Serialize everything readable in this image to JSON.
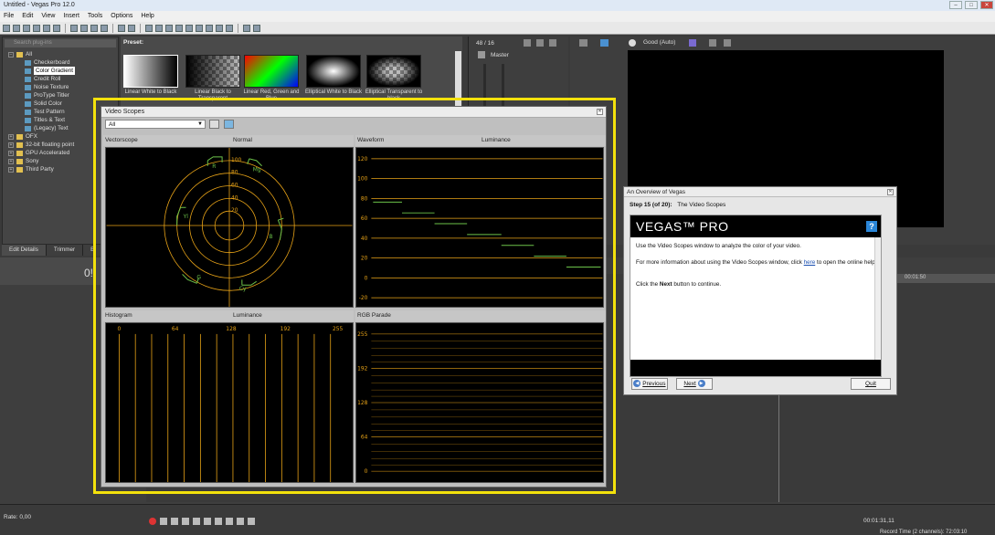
{
  "window": {
    "title": "Untitled - Vegas Pro 12.0"
  },
  "menu": [
    "File",
    "Edit",
    "View",
    "Insert",
    "Tools",
    "Options",
    "Help"
  ],
  "plugins": {
    "search_placeholder": "Search plug-ins",
    "tree": [
      {
        "label": "All",
        "level": 0,
        "type": "folder",
        "expanded": true
      },
      {
        "label": "Checkerboard",
        "level": 1,
        "type": "fx"
      },
      {
        "label": "Color Gradient",
        "level": 1,
        "type": "fx",
        "selected": true
      },
      {
        "label": "Credit Roll",
        "level": 1,
        "type": "fx"
      },
      {
        "label": "Noise Texture",
        "level": 1,
        "type": "fx"
      },
      {
        "label": "ProType Titler",
        "level": 1,
        "type": "fx"
      },
      {
        "label": "Solid Color",
        "level": 1,
        "type": "fx"
      },
      {
        "label": "Test Pattern",
        "level": 1,
        "type": "fx"
      },
      {
        "label": "Titles & Text",
        "level": 1,
        "type": "fx"
      },
      {
        "label": "(Legacy) Text",
        "level": 1,
        "type": "fx"
      },
      {
        "label": "OFX",
        "level": 0,
        "type": "folder"
      },
      {
        "label": "32-bit floating point",
        "level": 0,
        "type": "folder"
      },
      {
        "label": "GPU Accelerated",
        "level": 0,
        "type": "folder"
      },
      {
        "label": "Sony",
        "level": 0,
        "type": "folder"
      },
      {
        "label": "Third Party",
        "level": 0,
        "type": "folder"
      }
    ]
  },
  "presets": {
    "label": "Preset:",
    "items": [
      {
        "name": "Linear White to Black"
      },
      {
        "name": "Linear Black to Transparent"
      },
      {
        "name": "Linear Red, Green and Blue"
      },
      {
        "name": "Elliptical White to Black"
      },
      {
        "name": "Elliptical Transparent to black"
      }
    ]
  },
  "bottom_tabs": [
    "Edit Details",
    "Trimmer",
    "E"
  ],
  "mixer": {
    "count": "48 / 16",
    "bus": "Master"
  },
  "preview": {
    "quality": "Good (Auto)"
  },
  "ruler": {
    "time": "00:01:50"
  },
  "status": {
    "rate": "Rate: 0,00",
    "time": "00:01:31,11",
    "record_time": "Record Time (2 channels): 72:03:10"
  },
  "scopes": {
    "title": "Video Scopes",
    "source": "All",
    "vectorscope": {
      "label": "Vectorscope",
      "mode": "Normal",
      "rings": [
        "100",
        "80",
        "60",
        "40",
        "20"
      ],
      "targets": [
        "R",
        "Mg",
        "B",
        "Cy",
        "G",
        "Yl"
      ]
    },
    "waveform": {
      "label": "Waveform",
      "mode": "Luminance",
      "ticks": [
        "120",
        "100",
        "80",
        "60",
        "40",
        "20",
        "0",
        "-20"
      ]
    },
    "histogram": {
      "label": "Histogram",
      "mode": "Luminance",
      "ticks": [
        "0",
        "64",
        "128",
        "192",
        "255"
      ]
    },
    "parade": {
      "label": "RGB Parade",
      "ticks": [
        "255",
        "192",
        "128",
        "64",
        "0"
      ]
    }
  },
  "tutorial": {
    "title": "An Overview of Vegas",
    "step_label": "Step 15 (of 20):",
    "step_title": "The Video Scopes",
    "brand": "VEGAS™ PRO",
    "help_icon": "?",
    "para1": "Use the Video Scopes window to analyze the color of your video.",
    "para2a": "For more information about using the Video Scopes window, click",
    "para2link": "here",
    "para2b": "to open the online help.",
    "para3a": "Click the",
    "para3b": "Next",
    "para3c": "button to continue.",
    "prev": "Previous",
    "next": "Next",
    "quit": "Quit"
  },
  "colors": {
    "scope_line": "#e8a317",
    "highlight": "#f3e10c",
    "tut_link": "#1a4fb0"
  }
}
